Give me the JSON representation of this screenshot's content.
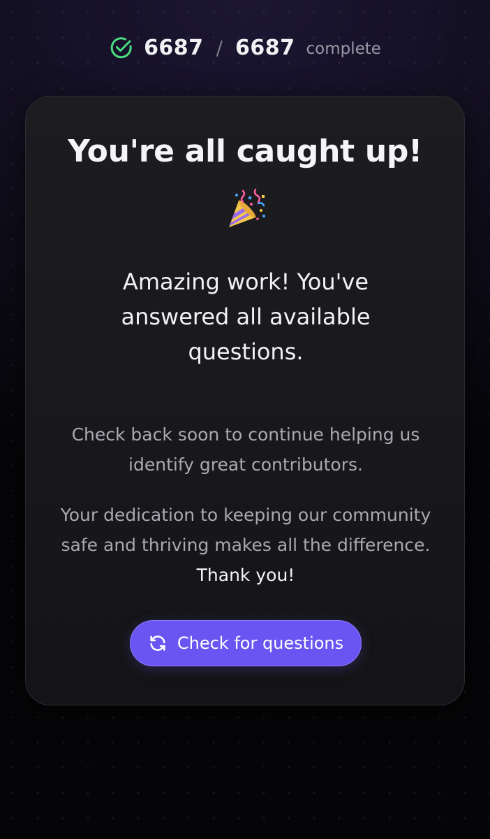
{
  "progress": {
    "icon": "check-circle-icon",
    "done": "6687",
    "separator": "/",
    "total": "6687",
    "label": "complete",
    "icon_color": "#4ade80"
  },
  "card": {
    "title": "You're all caught up!",
    "emoji_icon": "party-popper-icon",
    "subtitle": "Amazing work! You've answered all available questions.",
    "info_line_1": "Check back soon to continue helping us identify great contributors.",
    "info_line_2": "Your dedication to keeping our community safe and thriving makes all the difference.",
    "thanks": "Thank you!",
    "button": {
      "label": "Check for questions",
      "icon": "refresh-icon",
      "color": "#6a55f2"
    }
  }
}
